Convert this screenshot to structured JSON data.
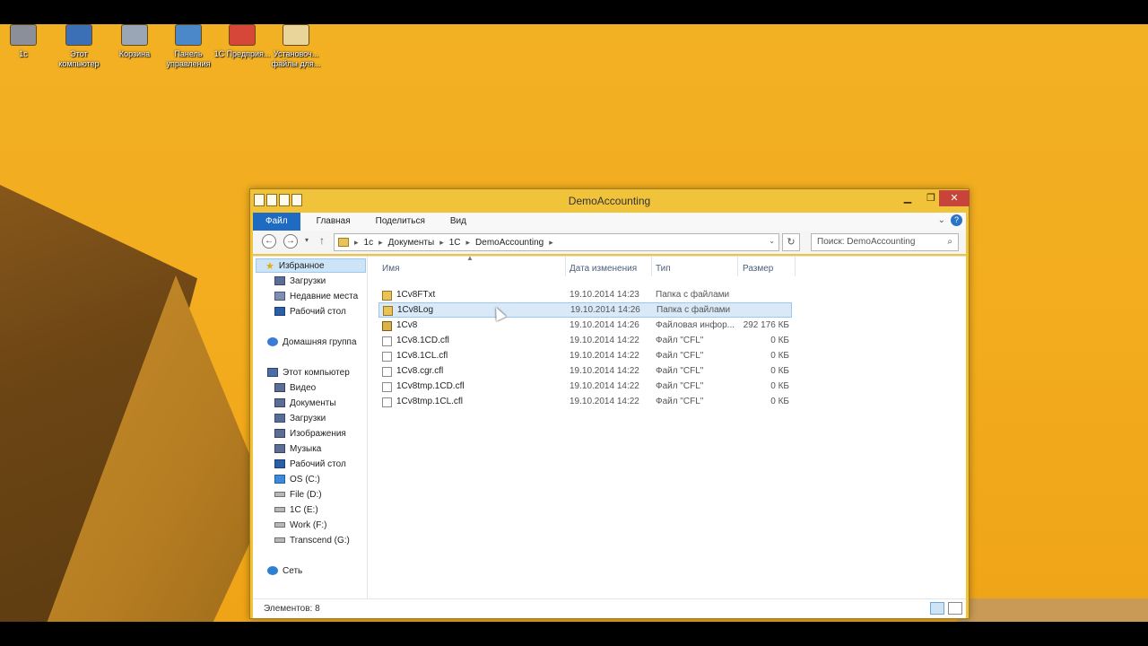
{
  "desktop_icons": [
    {
      "label": "1c"
    },
    {
      "label": "Этот компьютер"
    },
    {
      "label": "Корзина"
    },
    {
      "label": "Панель управления"
    },
    {
      "label": "1С Предприя..."
    },
    {
      "label": "Установоч... файлы для..."
    }
  ],
  "window": {
    "title": "DemoAccounting",
    "controls": {
      "minimize": "▁",
      "maximize": "❐",
      "close": "✕"
    }
  },
  "ribbon": {
    "tabs": [
      "Файл",
      "Главная",
      "Поделиться",
      "Вид"
    ],
    "expand_icon": "chevron-down-icon",
    "help_label": "?"
  },
  "nav": {
    "back": "←",
    "forward": "→",
    "dropdown": "▾",
    "up": "↑"
  },
  "address": {
    "crumbs": [
      "1c",
      "Документы",
      "1C",
      "DemoAccounting"
    ],
    "separator": "▸"
  },
  "search": {
    "placeholder": "Поиск: DemoAccounting",
    "icon": "search-icon"
  },
  "navpane": {
    "favorites": "Избранное",
    "favorites_items": [
      "Загрузки",
      "Недавние места",
      "Рабочий стол"
    ],
    "homegroup": "Домашняя группа",
    "computer": "Этот компьютер",
    "computer_items": [
      "Видео",
      "Документы",
      "Загрузки",
      "Изображения",
      "Музыка",
      "Рабочий стол"
    ],
    "drives": [
      "OS (C:)",
      "File (D:)",
      "1C (E:)",
      "Work (F:)",
      "Transcend (G:)"
    ],
    "network": "Сеть"
  },
  "columns": {
    "name": "Имя",
    "date": "Дата изменения",
    "type": "Тип",
    "size": "Размер"
  },
  "files": [
    {
      "name": "1Cv8FTxt",
      "date": "19.10.2014 14:23",
      "type": "Папка с файлами",
      "size": "",
      "icon": "folder"
    },
    {
      "name": "1Cv8Log",
      "date": "19.10.2014 14:26",
      "type": "Папка с файлами",
      "size": "",
      "icon": "folder"
    },
    {
      "name": "1Cv8",
      "date": "19.10.2014 14:26",
      "type": "Файловая инфор...",
      "size": "292 176 КБ",
      "icon": "db"
    },
    {
      "name": "1Cv8.1CD.cfl",
      "date": "19.10.2014 14:22",
      "type": "Файл \"CFL\"",
      "size": "0 КБ",
      "icon": "file"
    },
    {
      "name": "1Cv8.1CL.cfl",
      "date": "19.10.2014 14:22",
      "type": "Файл \"CFL\"",
      "size": "0 КБ",
      "icon": "file"
    },
    {
      "name": "1Cv8.cgr.cfl",
      "date": "19.10.2014 14:22",
      "type": "Файл \"CFL\"",
      "size": "0 КБ",
      "icon": "file"
    },
    {
      "name": "1Cv8tmp.1CD.cfl",
      "date": "19.10.2014 14:22",
      "type": "Файл \"CFL\"",
      "size": "0 КБ",
      "icon": "file"
    },
    {
      "name": "1Cv8tmp.1CL.cfl",
      "date": "19.10.2014 14:22",
      "type": "Файл \"CFL\"",
      "size": "0 КБ",
      "icon": "file"
    }
  ],
  "status": {
    "items_count": "Элементов: 8"
  },
  "colors": {
    "desktop_bg": "#f2b023",
    "window_frame": "#f0c33a",
    "file_tab": "#1f6bc1",
    "selection": "#d9e9f8",
    "close_button": "#c7443a"
  }
}
